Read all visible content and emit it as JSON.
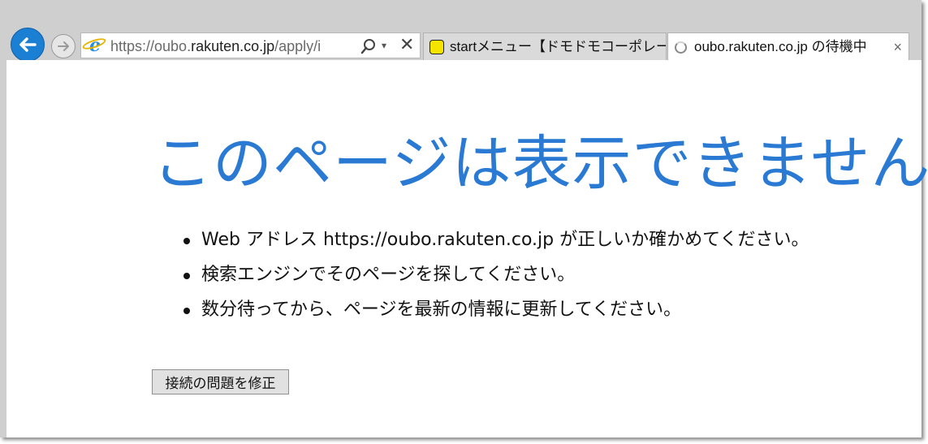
{
  "browser": {
    "address_bar": {
      "url_prefix": "https://oubo.",
      "url_host": "rakuten.co.jp",
      "url_suffix": "/apply/i"
    },
    "tabs": [
      {
        "title": "startメニュー【ドモドモコーポレーシ…",
        "active": false,
        "favicon": "yellow-face-icon"
      },
      {
        "title": "oubo.rakuten.co.jp の待機中",
        "active": true,
        "favicon": "loading-spinner-icon",
        "close": "×"
      }
    ]
  },
  "content": {
    "title": "このページは表示できません",
    "suggestions": [
      "Web アドレス https://oubo.rakuten.co.jp が正しいか確かめてください。",
      "検索エンジンでそのページを探してください。",
      "数分待ってから、ページを最新の情報に更新してください。"
    ],
    "fix_button_label": "接続の問題を修正"
  },
  "colors": {
    "title": "#2a7ad4",
    "back_button": "#1b7fd4",
    "chrome_background": "#cfcfcf"
  }
}
